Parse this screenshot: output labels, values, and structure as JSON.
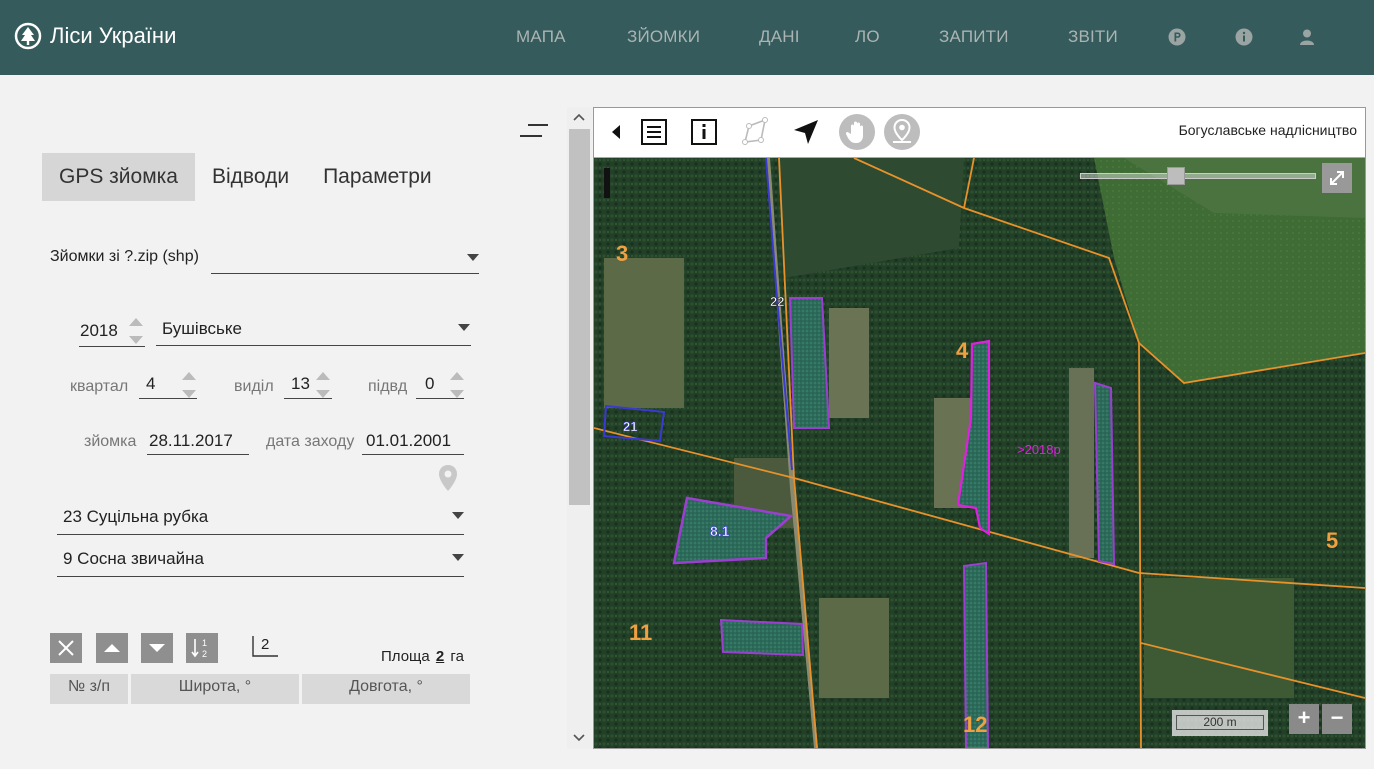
{
  "brand": {
    "title": "Ліси України"
  },
  "nav": {
    "items": [
      "МАПА",
      "ЗЙОМКИ",
      "ДАНІ",
      "ЛО",
      "ЗАПИТИ",
      "ЗВІТИ"
    ]
  },
  "tabs": [
    "GPS зйомка",
    "Відводи",
    "Параметри"
  ],
  "form": {
    "source_label": "Зйомки зі ?.zip (shp)",
    "source_value": "",
    "year": "2018",
    "forestry": "Бушівське",
    "kvartal_label": "квартал",
    "kvartal": "4",
    "vydil_label": "виділ",
    "vydil": "13",
    "pidvd_label": "підвд",
    "pidvd": "0",
    "survey_label": "зйомка",
    "survey_date": "28.11.2017",
    "action_date_label": "дата заходу",
    "action_date": "01.01.2001",
    "action_type": "23 Суцільна рубка",
    "species": "9 Сосна звичайна"
  },
  "table": {
    "decimals": "2",
    "area_label": "Площа",
    "area_value": "2",
    "area_unit": "га",
    "columns": [
      "№ з/п",
      "Широта, °",
      "Довгота, °"
    ]
  },
  "map": {
    "forestry_name": "Богуславське надлісництво",
    "scale_label": "200 m",
    "zoom_in": "+",
    "zoom_out": "−",
    "labels": {
      "q3": "3",
      "q4": "4",
      "q5": "5",
      "q11": "11",
      "q12": "12",
      "p22": "22",
      "p21": "21",
      "p81": "8.1",
      "ann": ">2018р"
    }
  },
  "colors": {
    "header": "#355b5c",
    "quarter_line": "#e8922b",
    "parcel_blue": "#3a3acf",
    "parcel_purple": "#9b3fd1",
    "parcel_magenta": "#e020e0",
    "cut_fill": "#2f6e5e"
  },
  "icons": {
    "nav": [
      "p-circle-icon",
      "info-icon",
      "user-icon"
    ],
    "map_tools": [
      "collapse-left-icon",
      "list-icon",
      "info-box-icon",
      "polygon-draw-icon",
      "navigate-arrow-icon",
      "pan-hand-icon",
      "pin-location-icon"
    ]
  }
}
